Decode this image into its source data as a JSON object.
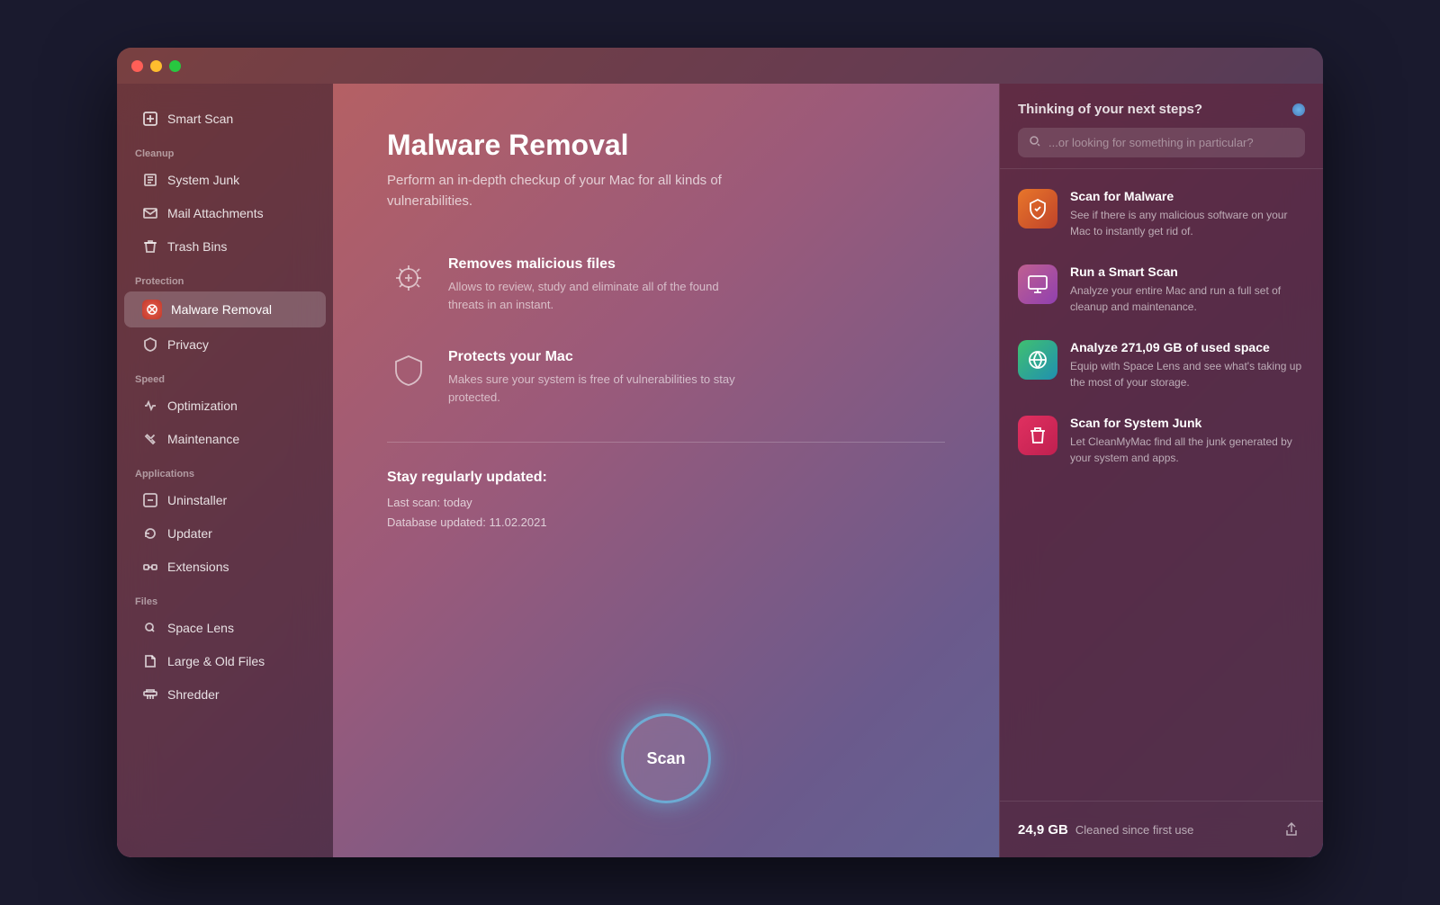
{
  "window": {
    "traffic_lights": [
      "close",
      "minimize",
      "maximize"
    ]
  },
  "sidebar": {
    "smart_scan": "Smart Scan",
    "sections": [
      {
        "label": "Cleanup",
        "items": [
          {
            "id": "system-junk",
            "label": "System Junk",
            "icon": "🗂"
          },
          {
            "id": "mail-attachments",
            "label": "Mail Attachments",
            "icon": "✉"
          },
          {
            "id": "trash-bins",
            "label": "Trash Bins",
            "icon": "🗑"
          }
        ]
      },
      {
        "label": "Protection",
        "items": [
          {
            "id": "malware-removal",
            "label": "Malware Removal",
            "icon": "🛡",
            "active": true
          },
          {
            "id": "privacy",
            "label": "Privacy",
            "icon": "👁"
          }
        ]
      },
      {
        "label": "Speed",
        "items": [
          {
            "id": "optimization",
            "label": "Optimization",
            "icon": "⚙"
          },
          {
            "id": "maintenance",
            "label": "Maintenance",
            "icon": "🔧"
          }
        ]
      },
      {
        "label": "Applications",
        "items": [
          {
            "id": "uninstaller",
            "label": "Uninstaller",
            "icon": "🗄"
          },
          {
            "id": "updater",
            "label": "Updater",
            "icon": "↺"
          },
          {
            "id": "extensions",
            "label": "Extensions",
            "icon": "🔌"
          }
        ]
      },
      {
        "label": "Files",
        "items": [
          {
            "id": "space-lens",
            "label": "Space Lens",
            "icon": "🔍"
          },
          {
            "id": "large-old-files",
            "label": "Large & Old Files",
            "icon": "📁"
          },
          {
            "id": "shredder",
            "label": "Shredder",
            "icon": "🖨"
          }
        ]
      }
    ]
  },
  "main": {
    "title": "Malware Removal",
    "subtitle": "Perform an in-depth checkup of your Mac for all kinds of vulnerabilities.",
    "features": [
      {
        "id": "removes-malicious",
        "title": "Removes malicious files",
        "description": "Allows to review, study and eliminate all of the found threats in an instant."
      },
      {
        "id": "protects-mac",
        "title": "Protects your Mac",
        "description": "Makes sure your system is free of vulnerabilities to stay protected."
      }
    ],
    "stay_updated": {
      "title": "Stay regularly updated:",
      "last_scan": "Last scan: today",
      "database_updated": "Database updated: 11.02.2021"
    },
    "scan_button": "Scan"
  },
  "right_panel": {
    "title": "Thinking of your next steps?",
    "search_placeholder": "...or looking for something in particular?",
    "items": [
      {
        "id": "scan-malware",
        "title": "Scan for Malware",
        "description": "See if there is any malicious software on your Mac to instantly get rid of.",
        "icon_class": "icon-malware"
      },
      {
        "id": "run-smart-scan",
        "title": "Run a Smart Scan",
        "description": "Analyze your entire Mac and run a full set of cleanup and maintenance.",
        "icon_class": "icon-smart"
      },
      {
        "id": "analyze-space",
        "title": "Analyze 271,09 GB of used space",
        "description": "Equip with Space Lens and see what's taking up the most of your storage.",
        "icon_class": "icon-space"
      },
      {
        "id": "scan-junk",
        "title": "Scan for System Junk",
        "description": "Let CleanMyMac find all the junk generated by your system and apps.",
        "icon_class": "icon-junk"
      }
    ],
    "footer": {
      "gb": "24,9 GB",
      "label": "Cleaned since first use"
    }
  }
}
